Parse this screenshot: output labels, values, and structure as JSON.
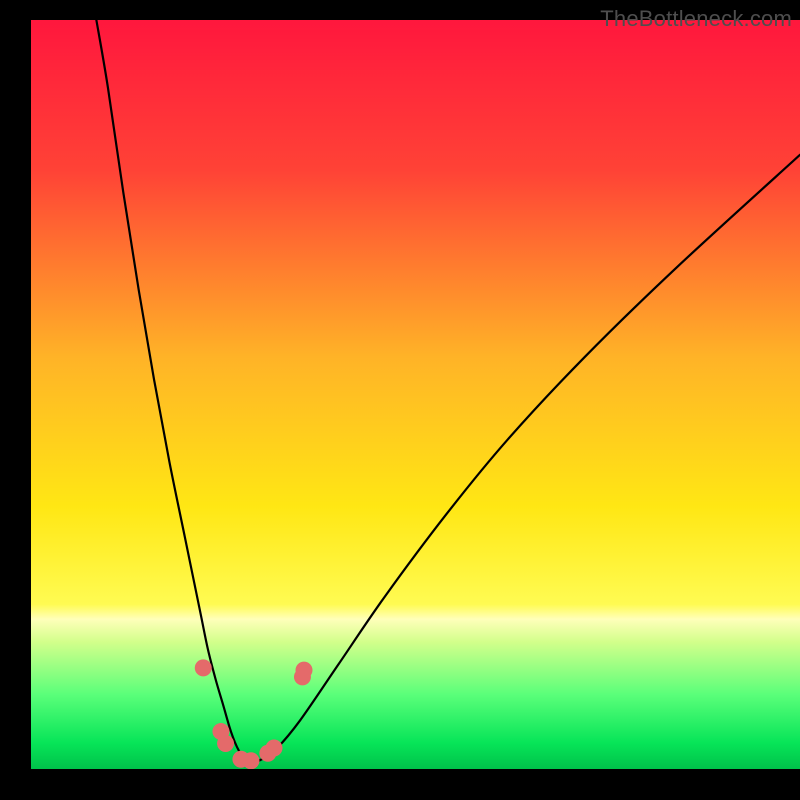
{
  "watermark": "TheBottleneck.com",
  "chart_data": {
    "type": "line",
    "title": "",
    "xlabel": "",
    "ylabel": "",
    "xlim": [
      0,
      100
    ],
    "ylim": [
      0,
      100
    ],
    "grid": false,
    "legend": false,
    "gradient_stops": [
      {
        "offset": 0.0,
        "color": "#ff173d"
      },
      {
        "offset": 0.2,
        "color": "#ff4236"
      },
      {
        "offset": 0.45,
        "color": "#ffb327"
      },
      {
        "offset": 0.65,
        "color": "#ffe714"
      },
      {
        "offset": 0.78,
        "color": "#fffb52"
      },
      {
        "offset": 0.8,
        "color": "#ffffba"
      },
      {
        "offset": 0.83,
        "color": "#d3ff8b"
      },
      {
        "offset": 0.9,
        "color": "#5bff7a"
      },
      {
        "offset": 0.965,
        "color": "#07e558"
      },
      {
        "offset": 1.0,
        "color": "#00c24a"
      }
    ],
    "series": [
      {
        "name": "bottleneck-curve",
        "x": [
          8.5,
          10,
          12,
          14,
          16,
          18,
          20,
          22,
          23,
          24,
          25,
          26,
          27,
          28,
          29,
          30,
          32,
          35,
          40,
          46,
          54,
          62,
          72,
          84,
          100
        ],
        "y": [
          100,
          91,
          77,
          64,
          52,
          41,
          31,
          21,
          16,
          12,
          8.5,
          5,
          2.5,
          1.2,
          1,
          1.3,
          2.8,
          6.5,
          14,
          23,
          34,
          44,
          55,
          67,
          82
        ]
      }
    ],
    "markers": {
      "name": "curve-points",
      "color": "#e46a6a",
      "radius": 8.5,
      "points": [
        {
          "x": 22.4,
          "y": 13.5
        },
        {
          "x": 24.7,
          "y": 5.0
        },
        {
          "x": 25.3,
          "y": 3.4
        },
        {
          "x": 27.3,
          "y": 1.3
        },
        {
          "x": 28.6,
          "y": 1.1
        },
        {
          "x": 30.8,
          "y": 2.1
        },
        {
          "x": 31.6,
          "y": 2.8
        },
        {
          "x": 35.3,
          "y": 12.3
        },
        {
          "x": 35.5,
          "y": 13.2
        }
      ]
    }
  }
}
